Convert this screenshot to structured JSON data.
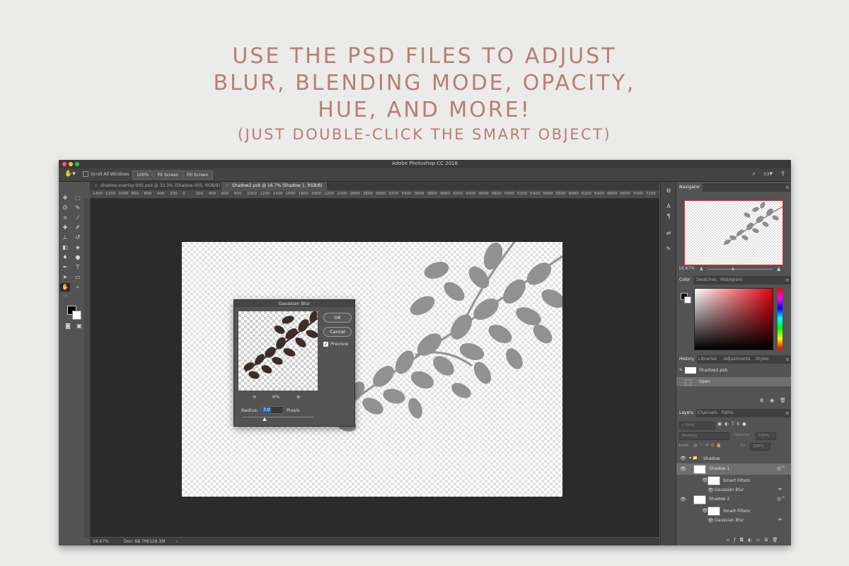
{
  "headline": {
    "line1": "USE THE PSD FILES TO ADJUST",
    "line2": "BLUR, BLENDING MODE, OPACITY,",
    "line3": "HUE, AND MORE!",
    "line4": "(JUST DOUBLE-CLICK THE SMART OBJECT)"
  },
  "app": {
    "title": "Adobe Photoshop CC 2018"
  },
  "options_bar": {
    "scroll_all_windows": "Scroll All Windows",
    "zoom_btn": "100%",
    "fit_screen": "Fit Screen",
    "fill_screen": "Fill Screen"
  },
  "tabs": [
    {
      "label": "shadow-overlay-005.psd @ 33.3% (Shadow-005, RGB/8)",
      "active": false
    },
    {
      "label": "Shadow2.psb @ 16.7% (Shadow 1, RGB/8)",
      "active": true
    }
  ],
  "ruler": {
    "numbers": [
      "1400",
      "1200",
      "1000",
      "800",
      "600",
      "400",
      "200",
      "0",
      "200",
      "400",
      "600",
      "800",
      "1000",
      "1200",
      "1400",
      "1600",
      "1800",
      "2000",
      "2200",
      "2400",
      "2600",
      "2800",
      "3000",
      "3200",
      "3400",
      "3600",
      "3800",
      "4000",
      "4200",
      "4400",
      "4600",
      "4800",
      "5000",
      "5200",
      "5400",
      "5600",
      "5800",
      "6000",
      "6200",
      "6400",
      "6600",
      "6800",
      "7000",
      "7200"
    ]
  },
  "status": {
    "zoom": "16.67%",
    "doc": "Doc: 68.7M/126.3M",
    "arrow": "›"
  },
  "gaussian_blur": {
    "title": "Gaussian Blur",
    "ok": "OK",
    "cancel": "Cancel",
    "preview_label": "Preview",
    "preview_checked": "✓",
    "zoom_pct": "6%",
    "radius_label": "Radius:",
    "radius_value": "7.0",
    "radius_unit": "Pixels"
  },
  "navigator": {
    "tab": "Navigator",
    "zoom": "16.67%"
  },
  "color_panel": {
    "tabs": [
      "Color",
      "Swatches",
      "Histogram"
    ]
  },
  "history_panel": {
    "tabs": [
      "History",
      "Libraries",
      "Adjustments",
      "Styles"
    ],
    "snapshot": "Shadow2.psb",
    "items": [
      "Open"
    ]
  },
  "layers_panel": {
    "tabs": [
      "Layers",
      "Channels",
      "Paths"
    ],
    "filter_kind": "Kind",
    "blend_mode": "Multiply",
    "opacity_label": "Opacity:",
    "opacity_value": "100%",
    "lock_label": "Lock:",
    "fill_label": "Fill:",
    "fill_value": "100%",
    "group": "Shadow",
    "layers": [
      {
        "name": "Shadow 1",
        "smart_filters": "Smart Filters",
        "filter": "Gaussian Blur",
        "selected": true
      },
      {
        "name": "Shadow 2",
        "smart_filters": "Smart Filters",
        "filter": "Gaussian Blur",
        "selected": false
      }
    ]
  },
  "colors": {
    "headline": "#b87f72",
    "window_bg": "#535353",
    "canvas_bg": "#2b2b2b",
    "leaf_shadow": "#8c8c8c",
    "leaf_dark": "#3b2d28"
  }
}
